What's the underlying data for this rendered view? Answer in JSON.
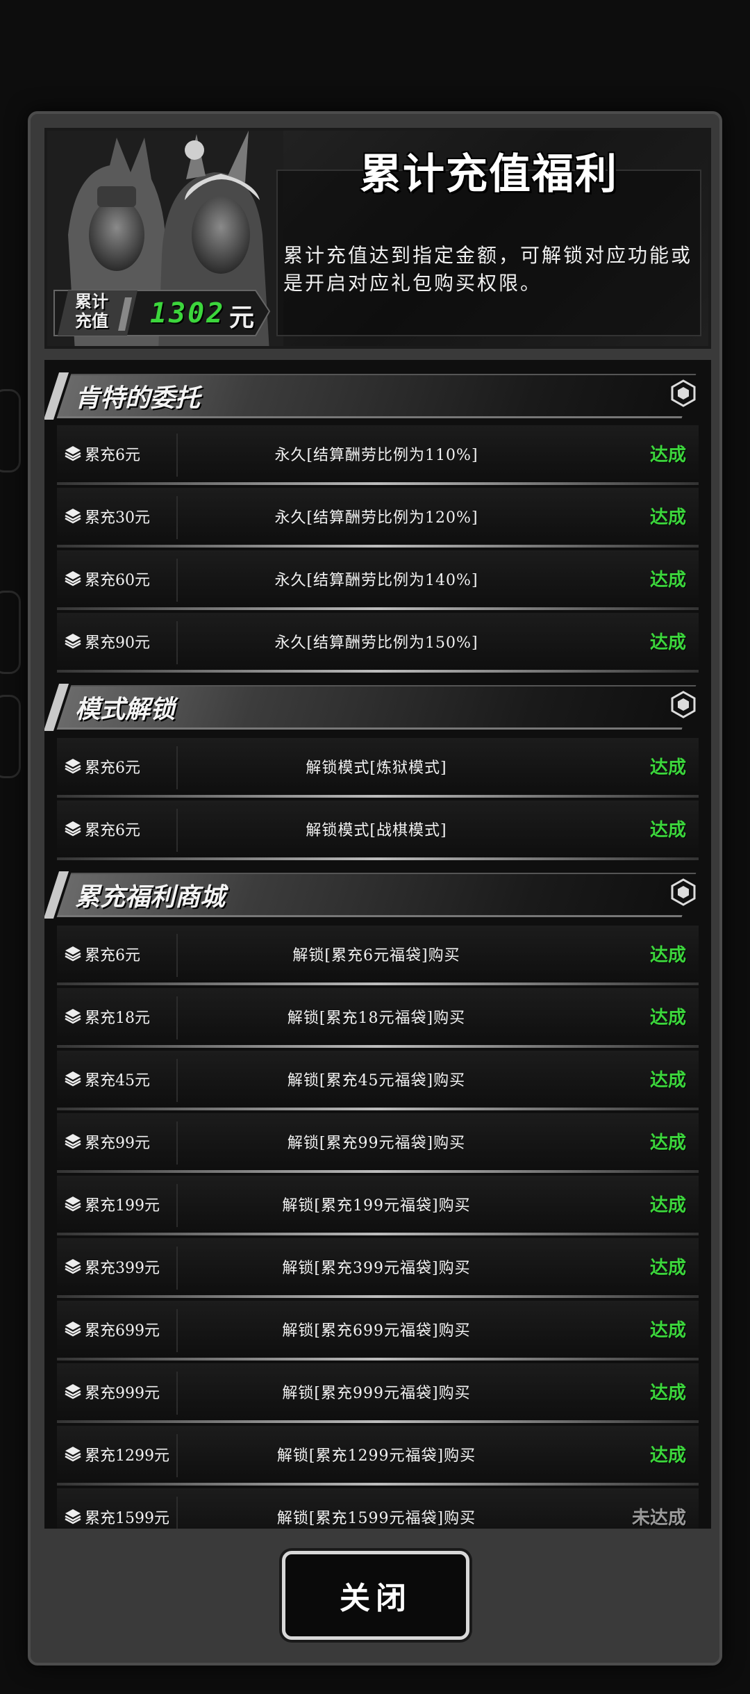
{
  "header": {
    "title": "累计充值福利",
    "description": "累计充值达到指定金额，可解锁对应功能或是开启对应礼包购买权限。",
    "recharge_label_line1": "累计",
    "recharge_label_line2": "充值",
    "recharge_amount": "1302",
    "recharge_unit": "元"
  },
  "sections": [
    {
      "title": "肯特的委托",
      "rows": [
        {
          "requirement": "累充6元",
          "reward": "永久[结算酬劳比例为110%]",
          "status": "达成"
        },
        {
          "requirement": "累充30元",
          "reward": "永久[结算酬劳比例为120%]",
          "status": "达成"
        },
        {
          "requirement": "累充60元",
          "reward": "永久[结算酬劳比例为140%]",
          "status": "达成"
        },
        {
          "requirement": "累充90元",
          "reward": "永久[结算酬劳比例为150%]",
          "status": "达成"
        }
      ]
    },
    {
      "title": "模式解锁",
      "rows": [
        {
          "requirement": "累充6元",
          "reward": "解锁模式[炼狱模式]",
          "status": "达成"
        },
        {
          "requirement": "累充6元",
          "reward": "解锁模式[战棋模式]",
          "status": "达成"
        }
      ]
    },
    {
      "title": "累充福利商城",
      "rows": [
        {
          "requirement": "累充6元",
          "reward": "解锁[累充6元福袋]购买",
          "status": "达成"
        },
        {
          "requirement": "累充18元",
          "reward": "解锁[累充18元福袋]购买",
          "status": "达成"
        },
        {
          "requirement": "累充45元",
          "reward": "解锁[累充45元福袋]购买",
          "status": "达成"
        },
        {
          "requirement": "累充99元",
          "reward": "解锁[累充99元福袋]购买",
          "status": "达成"
        },
        {
          "requirement": "累充199元",
          "reward": "解锁[累充199元福袋]购买",
          "status": "达成"
        },
        {
          "requirement": "累充399元",
          "reward": "解锁[累充399元福袋]购买",
          "status": "达成"
        },
        {
          "requirement": "累充699元",
          "reward": "解锁[累充699元福袋]购买",
          "status": "达成"
        },
        {
          "requirement": "累充999元",
          "reward": "解锁[累充999元福袋]购买",
          "status": "达成"
        },
        {
          "requirement": "累充1299元",
          "reward": "解锁[累充1299元福袋]购买",
          "status": "达成"
        },
        {
          "requirement": "累充1599元",
          "reward": "解锁[累充1599元福袋]购买",
          "status": "未达成"
        }
      ]
    }
  ],
  "close_button": {
    "label": "关闭"
  },
  "colors": {
    "achieved": "#3cd63c",
    "pending": "#9a9a9a"
  }
}
